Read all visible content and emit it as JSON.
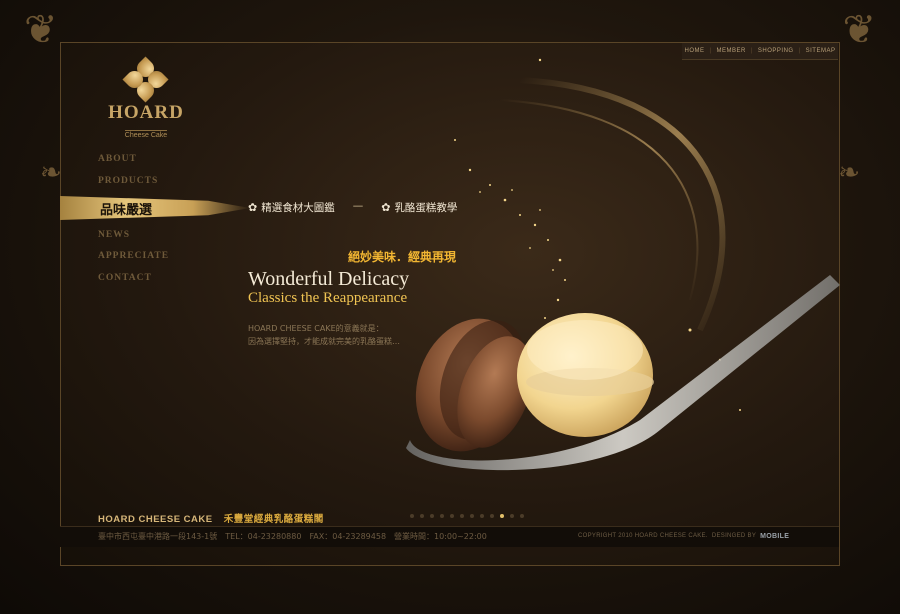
{
  "topnav": {
    "items": [
      "HOME",
      "MEMBER",
      "SHOPPING",
      "SITEMAP"
    ]
  },
  "logo": {
    "name": "HOARD",
    "sub": "Cheese Cake"
  },
  "sidebar": {
    "items": [
      "ABOUT",
      "PRODUCTS",
      "NEWS",
      "APPRECIATE",
      "CONTACT"
    ],
    "active": "品味嚴選"
  },
  "submenu": {
    "items": [
      "精選食材大圖鑑",
      "乳酪蛋糕教學"
    ]
  },
  "hero": {
    "tagline_cn": "絕妙美味．經典再現",
    "headline1": "Wonderful Delicacy",
    "headline2": "Classics the Reappearance",
    "desc_line1": "HOARD CHEESE CAKE的意義就是：",
    "desc_line2": "因為選擇堅持，才能成就完美的乳酪蛋糕…"
  },
  "footer": {
    "brand": "HOARD CHEESE CAKE",
    "brand_cn": "禾豐堂經典乳酪蛋糕閣",
    "address": "臺中市西屯臺中港路一段143-1號",
    "tel": "TEL：04-23280880",
    "fax": "FAX：04-23289458",
    "hours": "營業時間：10:00~22:00",
    "copyright": "COPYRIGHT 2010 HOARD CHEESE CAKE.",
    "designed": "DESINGED BY",
    "designer": "MOBILE"
  },
  "slider": {
    "count": 12,
    "active_index": 9
  }
}
